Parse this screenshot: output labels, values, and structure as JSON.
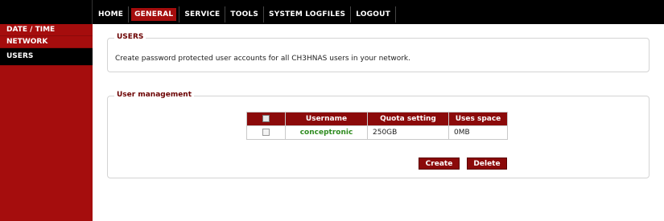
{
  "nav": {
    "items": [
      {
        "label": "HOME"
      },
      {
        "label": "GENERAL"
      },
      {
        "label": "SERVICE"
      },
      {
        "label": "TOOLS"
      },
      {
        "label": "SYSTEM LOGFILES"
      },
      {
        "label": "LOGOUT"
      }
    ],
    "active": "GENERAL"
  },
  "sidebar": {
    "items": [
      {
        "label": "DATE / TIME"
      },
      {
        "label": "NETWORK"
      },
      {
        "label": "USERS"
      }
    ],
    "active": "USERS"
  },
  "users_section": {
    "legend": "USERS",
    "description": "Create password protected user accounts for all CH3HNAS users in your network."
  },
  "management_section": {
    "legend": "User management",
    "table": {
      "headers": [
        "",
        "Username",
        "Quota setting",
        "Uses space"
      ],
      "rows": [
        {
          "username": "conceptronic",
          "quota": "250GB",
          "space": "0MB"
        }
      ]
    },
    "create_label": "Create",
    "delete_label": "Delete"
  },
  "colors": {
    "brand_red": "#a50d0d",
    "header_red": "#8b0a0a",
    "username_green": "#2e8b1f"
  }
}
